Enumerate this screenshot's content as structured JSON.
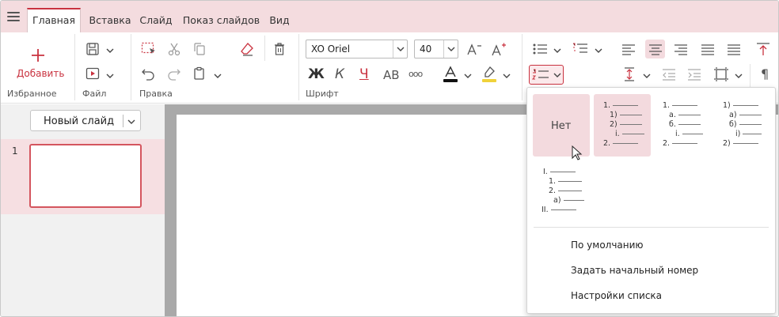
{
  "tabs": [
    {
      "label": "Главная",
      "active": true
    },
    {
      "label": "Вставка"
    },
    {
      "label": "Слайд"
    },
    {
      "label": "Показ слайдов"
    },
    {
      "label": "Вид"
    }
  ],
  "ribbon": {
    "add_label": "Добавить",
    "groups": {
      "favorites": "Избранное",
      "file": "Файл",
      "edit": "Правка",
      "font": "Шрифт"
    },
    "font_name": "XO Oriel",
    "font_size": "40",
    "font_buttons": {
      "bold": "Ж",
      "italic": "К",
      "underline": "Ч",
      "caps": "АВ",
      "more": "ооо"
    },
    "accent_color": "#c9323f"
  },
  "left_pane": {
    "new_slide_label": "Новый слайд",
    "slides": [
      {
        "number": "1"
      }
    ]
  },
  "numbering_popup": {
    "none_label": "Нет",
    "presets": [
      {
        "lines": [
          "1.",
          "1)",
          "2)",
          "i.",
          "2."
        ]
      },
      {
        "lines": [
          "1.",
          "a.",
          "б.",
          "i.",
          "2."
        ]
      },
      {
        "lines": [
          "1)",
          "a)",
          "б)",
          "i)",
          "2)"
        ]
      },
      {
        "lines": [
          "I.",
          "1.",
          "2.",
          "a)",
          "II."
        ]
      }
    ],
    "menu_items": [
      "По умолчанию",
      "Задать начальный номер",
      "Настройки списка"
    ]
  }
}
